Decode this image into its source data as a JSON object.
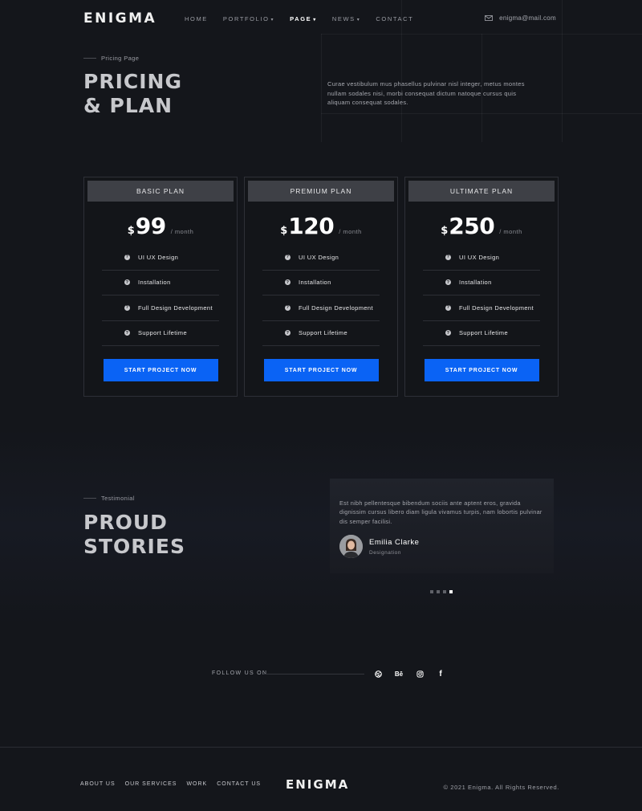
{
  "header": {
    "logo": "ENIGMA",
    "nav": [
      {
        "label": "HOME",
        "dropdown": false,
        "active": false
      },
      {
        "label": "PORTFOLIO",
        "dropdown": true,
        "active": false
      },
      {
        "label": "PAGE",
        "dropdown": true,
        "active": true
      },
      {
        "label": "NEWS",
        "dropdown": true,
        "active": false
      },
      {
        "label": "CONTACT",
        "dropdown": false,
        "active": false
      }
    ],
    "email": "enigma@mail.com",
    "email_icon": "mail-icon"
  },
  "hero": {
    "eyebrow": "Pricing Page",
    "title_line1": "PRICING",
    "title_line2": "& PLAN",
    "description": "Curae vestibulum mus phasellus pulvinar nisl integer, metus montes nullam sodales nisi, morbi consequat dictum  natoque cursus quis aliquam  consequat sodales."
  },
  "pricing": {
    "plans": [
      {
        "name": "BASIC PLAN",
        "currency": "$",
        "amount": "99",
        "period": "/ month",
        "features": [
          "UI UX Design",
          "Installation",
          "Full Design Development",
          "Support Lifetime"
        ],
        "cta": "START PROJECT NOW"
      },
      {
        "name": "PREMIUM PLAN",
        "currency": "$",
        "amount": "120",
        "period": "/ month",
        "features": [
          "UI UX Design",
          "Installation",
          "Full Design Development",
          "Support Lifetime"
        ],
        "cta": "START PROJECT NOW"
      },
      {
        "name": "ULTIMATE PLAN",
        "currency": "$",
        "amount": "250",
        "period": "/ month",
        "features": [
          "UI UX Design",
          "Installation",
          "Full Design Development",
          "Support Lifetime"
        ],
        "cta": "START PROJECT NOW"
      }
    ],
    "feature_icon": "question-icon",
    "accent_color": "#0a63f5"
  },
  "testimonial": {
    "eyebrow": "Testimonial",
    "title_line1": "PROUD",
    "title_line2": "STORIES",
    "quote": "Est nibh pellentesque bibendum sociis ante aptent eros, gravida dignissim cursus libero diam ligula vivamus turpis, nam lobortis pulvinar dis semper facilisi.",
    "name": "Emilia Clarke",
    "role": "Designation",
    "slide_count": 4,
    "active_slide": 4
  },
  "follow": {
    "label": "FOLLOW US ON",
    "icons": [
      "dribbble-icon",
      "behance-icon",
      "instagram-icon",
      "facebook-icon"
    ],
    "behance_text": "Bē",
    "facebook_text": "f"
  },
  "footer": {
    "links": [
      "ABOUT US",
      "OUR SERVICES",
      "WORK",
      "CONTACT US"
    ],
    "logo": "ENIGMA",
    "copyright": "© 2021 Enigma. All Rights Reserved."
  }
}
